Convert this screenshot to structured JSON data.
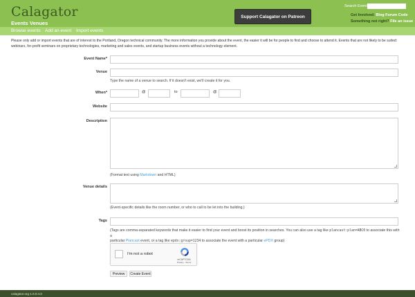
{
  "header": {
    "logo": "Calagator",
    "patreon_button": "Support Calagator on Patreon",
    "search_label": "Search Events",
    "search_placeholder": "",
    "get_involved_label": "Get Involved:",
    "get_involved_links": [
      "Blog",
      "Forum",
      "Code"
    ],
    "something_wrong_label": "Something not right?",
    "file_issue_link": "File an issue"
  },
  "nav": {
    "primary": [
      "Events",
      "Venues"
    ],
    "sub": [
      "Browse events",
      "Add an event",
      "Import events"
    ]
  },
  "intro": "Please only add or import events that are of interest to the Portland, Oregon technical community. The more information you provide about the event, the easier it will be for people to find and choose to attend it. Events that are not likely to be suited: webinars, for-profit seminars on proprietary technologies, marketing and sales events, and startup business events without a technology element.",
  "form": {
    "event_name_label": "Event Name*",
    "venue_label": "Venue",
    "venue_help": "Type the name of a venue to search. If it doesn't exist, we'll create it for you.",
    "when_label": "When*",
    "at_1": "@",
    "to": "to",
    "at_2": "@",
    "website_label": "Website",
    "description_label": "Description",
    "description_help_prefix": "(Format text using ",
    "description_help_link": "Markdown",
    "description_help_suffix": " and HTML)",
    "venue_details_label": "Venue details",
    "venue_details_help": "(Event-specific details like the room number, or who to call to be let into the building.)",
    "tags_label": "Tags",
    "tags_help_1": "(Tags are comma-separated keywords that make it easier to find your event and boost its position in searches. You can also use a tag like ",
    "tags_code_1": "plancast:plan=ABC0",
    "tags_help_2": " to associate this with a",
    "tags_help_3": "particular ",
    "tags_link_1": "Plancast",
    "tags_help_4": " event, or a tag like ",
    "tags_code_2": "epdx:group=1234",
    "tags_help_5": " to associate the event with a particular ",
    "tags_link_2": "ePDX",
    "tags_help_6": " group)"
  },
  "captcha": {
    "label": "I'm not a robot",
    "brand": "reCAPTCHA",
    "terms": "Privacy - Terms"
  },
  "buttons": {
    "preview": "Preview",
    "create": "Create Event"
  },
  "footer": {
    "version": "calagator.org 1.0.0.rc3"
  },
  "colors": {
    "header_green": "#8cc152",
    "subnav_green": "#a8d672",
    "footer_green": "#3c4f2a",
    "link_blue": "#46a0d8"
  }
}
